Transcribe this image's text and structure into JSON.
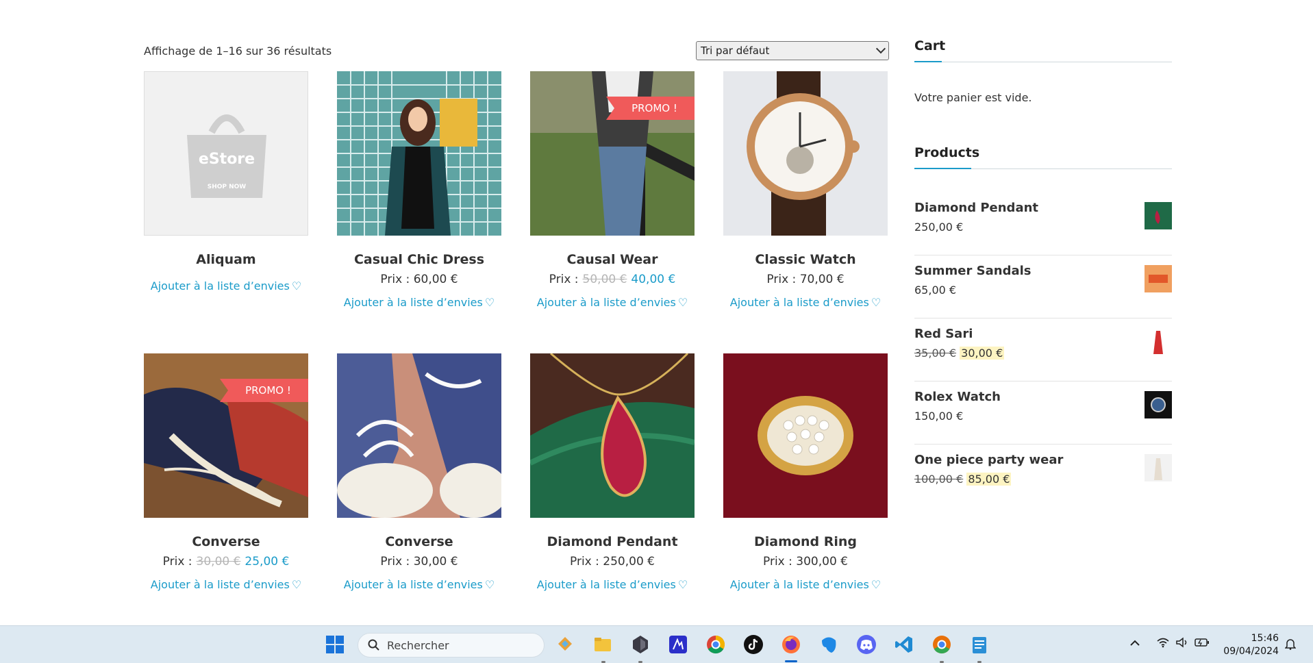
{
  "shop": {
    "result_count": "Affichage de 1–16 sur 36 résultats",
    "sort_selected": "Tri par défaut",
    "wishlist_label": "Ajouter à la liste d’envies",
    "price_prefix": "Prix :",
    "promo_label": "PROMO !",
    "placeholder_logo": {
      "brand": "eStore",
      "tagline": "SHOP NOW"
    },
    "products": [
      {
        "name": "Aliquam",
        "price": "",
        "old_price": "",
        "new_price": "",
        "promo": false
      },
      {
        "name": "Casual Chic Dress",
        "price": "60,00 €",
        "old_price": "",
        "new_price": "",
        "promo": false
      },
      {
        "name": "Causal Wear",
        "price": "",
        "old_price": "50,00 €",
        "new_price": "40,00 €",
        "promo": true
      },
      {
        "name": "Classic Watch",
        "price": "70,00 €",
        "old_price": "",
        "new_price": "",
        "promo": false
      },
      {
        "name": "Converse",
        "price": "",
        "old_price": "30,00 €",
        "new_price": "25,00 €",
        "promo": true
      },
      {
        "name": "Converse",
        "price": "30,00 €",
        "old_price": "",
        "new_price": "",
        "promo": false
      },
      {
        "name": "Diamond Pendant",
        "price": "250,00 €",
        "old_price": "",
        "new_price": "",
        "promo": false
      },
      {
        "name": "Diamond Ring",
        "price": "300,00 €",
        "old_price": "",
        "new_price": "",
        "promo": false
      }
    ]
  },
  "sidebar": {
    "cart_title": "Cart",
    "cart_empty": "Votre panier est vide.",
    "products_title": "Products",
    "products": [
      {
        "name": "Diamond Pendant",
        "price": "250,00 €",
        "old_price": "",
        "new_price": ""
      },
      {
        "name": "Summer Sandals",
        "price": "65,00 €",
        "old_price": "",
        "new_price": ""
      },
      {
        "name": "Red Sari",
        "price": "",
        "old_price": "35,00 €",
        "new_price": "30,00 €"
      },
      {
        "name": "Rolex Watch",
        "price": "150,00 €",
        "old_price": "",
        "new_price": ""
      },
      {
        "name": "One piece party wear",
        "price": "",
        "old_price": "100,00 €",
        "new_price": "85,00 €"
      }
    ]
  },
  "taskbar": {
    "search_placeholder": "Rechercher",
    "time": "15:46",
    "date": "09/04/2024",
    "apps": [
      "start-icon",
      "widgets-icon",
      "file-explorer-icon",
      "obsidian-icon",
      "app-icon",
      "chrome-icon",
      "tiktok-icon",
      "firefox-icon",
      "evernote-icon",
      "discord-icon",
      "vscode-icon",
      "chrome-canary-icon",
      "notepad-icon"
    ]
  },
  "colors": {
    "accent": "#1a9bc9",
    "promo": "#f05a5a",
    "highlight": "#fdf4c2"
  }
}
